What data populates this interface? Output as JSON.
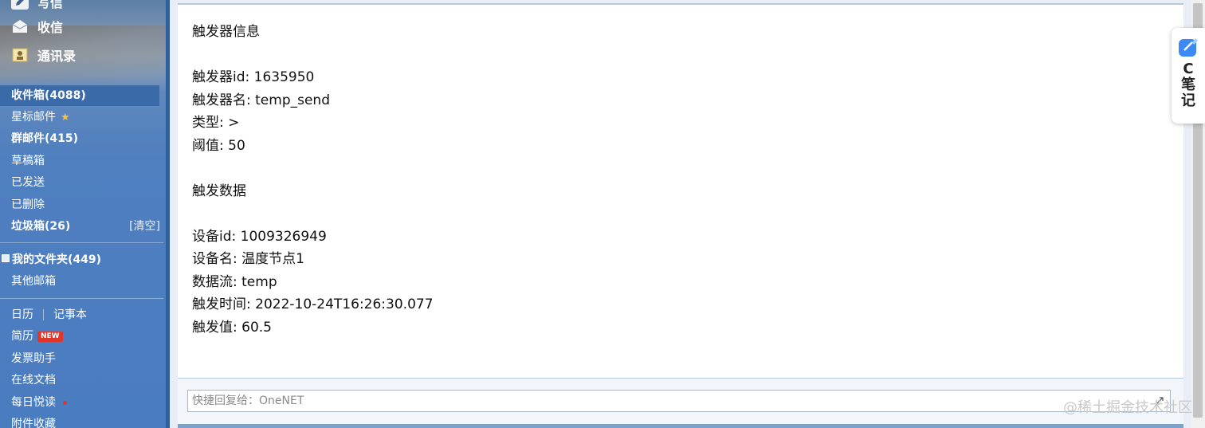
{
  "sidebar": {
    "top_nav": [
      {
        "label": "写信",
        "icon": "compose-icon"
      },
      {
        "label": "收信",
        "icon": "inbox-icon"
      },
      {
        "label": "通讯录",
        "icon": "contacts-icon"
      }
    ],
    "folders": {
      "inbox": "收件箱(4088)",
      "starred": "星标邮件",
      "group": "群邮件(415)",
      "drafts": "草稿箱",
      "sent": "已发送",
      "deleted": "已删除",
      "spam": "垃圾箱(26)",
      "spam_action": "[清空]",
      "my_folders": "我的文件夹(449)",
      "other_mailbox": "其他邮箱"
    },
    "tools": {
      "calendar": "日历",
      "notebook": "记事本",
      "resume": "简历",
      "resume_badge": "NEW",
      "invoice": "发票助手",
      "docs": "在线文档",
      "daily_read": "每日悦读",
      "attachments": "附件收藏"
    }
  },
  "mail": {
    "lines": [
      "触发器信息",
      "",
      "触发器id: 1635950",
      "触发器名: temp_send",
      "类型: >",
      "阈值: 50",
      "",
      "触发数据",
      "",
      "设备id: 1009326949",
      "设备名: 温度节点1",
      "数据流: temp",
      "触发时间: 2022-10-24T16:26:30.077",
      "触发值: 60.5"
    ]
  },
  "quick_reply": {
    "placeholder": "快捷回复给：OneNET"
  },
  "note_widget": {
    "text": "C\n笔\n记"
  },
  "watermark": "@稀土掘金技术社区",
  "colors": {
    "sidebar_blue": "#4a7cc0",
    "active_folder": "#3b6aa8",
    "new_badge": "#e0352b",
    "star": "#f7c242"
  }
}
